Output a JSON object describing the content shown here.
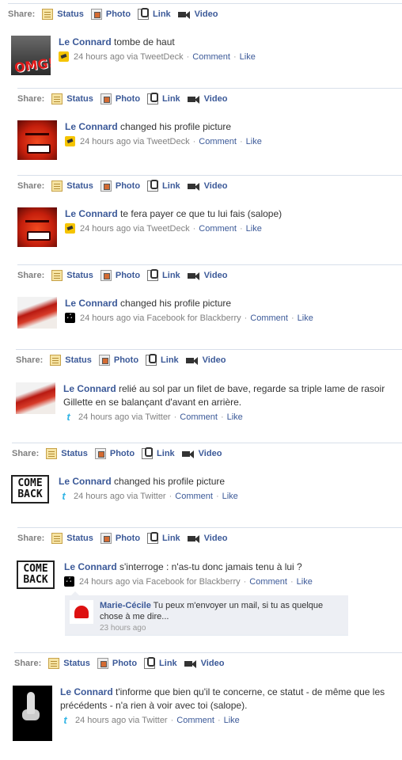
{
  "share": {
    "label": "Share:",
    "status": "Status",
    "photo": "Photo",
    "link": "Link",
    "video": "Video"
  },
  "stories": [
    {
      "actor": "Le Connard",
      "text": "tombe de haut",
      "time": "24 hours ago",
      "via": "via TweetDeck",
      "source": "tweetdeck-icon",
      "avatar": "omg",
      "comment": "Comment",
      "like": "Like"
    },
    {
      "actor": "Le Connard",
      "text": "changed his profile picture",
      "time": "24 hours ago",
      "via": "via TweetDeck",
      "source": "tweetdeck-icon",
      "avatar": "red-face",
      "comment": "Comment",
      "like": "Like"
    },
    {
      "actor": "Le Connard",
      "text": "te fera payer ce que tu lui fais (salope)",
      "time": "24 hours ago",
      "via": "via TweetDeck",
      "source": "tweetdeck-icon",
      "avatar": "red-face",
      "comment": "Comment",
      "like": "Like"
    },
    {
      "actor": "Le Connard",
      "text": "changed his profile picture",
      "time": "24 hours ago",
      "via": "via Facebook for Blackberry",
      "source": "blackberry-icon",
      "avatar": "blade",
      "comment": "Comment",
      "like": "Like"
    },
    {
      "actor": "Le Connard",
      "text": "relié au sol par un filet de bave, regarde sa triple lame de rasoir Gillette en se balançant d'avant en arrière.",
      "time": "24 hours ago",
      "via": "via Twitter",
      "source": "twitter-icon",
      "avatar": "blade",
      "comment": "Comment",
      "like": "Like"
    },
    {
      "actor": "Le Connard",
      "text": "changed his profile picture",
      "time": "24 hours ago",
      "via": "via Twitter",
      "source": "twitter-icon",
      "avatar": "come-back",
      "comment": "Comment",
      "like": "Like"
    },
    {
      "actor": "Le Connard",
      "text": "s'interroge : n'as-tu donc jamais tenu à lui ?",
      "time": "24 hours ago",
      "via": "via Facebook for Blackberry",
      "source": "blackberry-icon",
      "avatar": "come-back",
      "comment": "Comment",
      "like": "Like"
    },
    {
      "actor": "Le Connard",
      "text": "t'informe que bien qu'il te concerne, ce statut - de même que les précédents - n'a rien à voir avec toi (salope).",
      "time": "24 hours ago",
      "via": "via Twitter",
      "source": "twitter-icon",
      "avatar": "finger",
      "comment": "Comment",
      "like": "Like"
    }
  ],
  "come_back_text": [
    "COME",
    "BACK"
  ],
  "omg_text": "OMG!",
  "comment_box": {
    "author": "Marie-Cécile",
    "text": "Tu peux m'envoyer un mail, si tu as quelque chose à me dire...",
    "time": "23 hours ago"
  },
  "colors": {
    "link": "#3b5998",
    "meta": "#808080",
    "border": "#d8dfea",
    "comment_bg": "#edeff4"
  }
}
